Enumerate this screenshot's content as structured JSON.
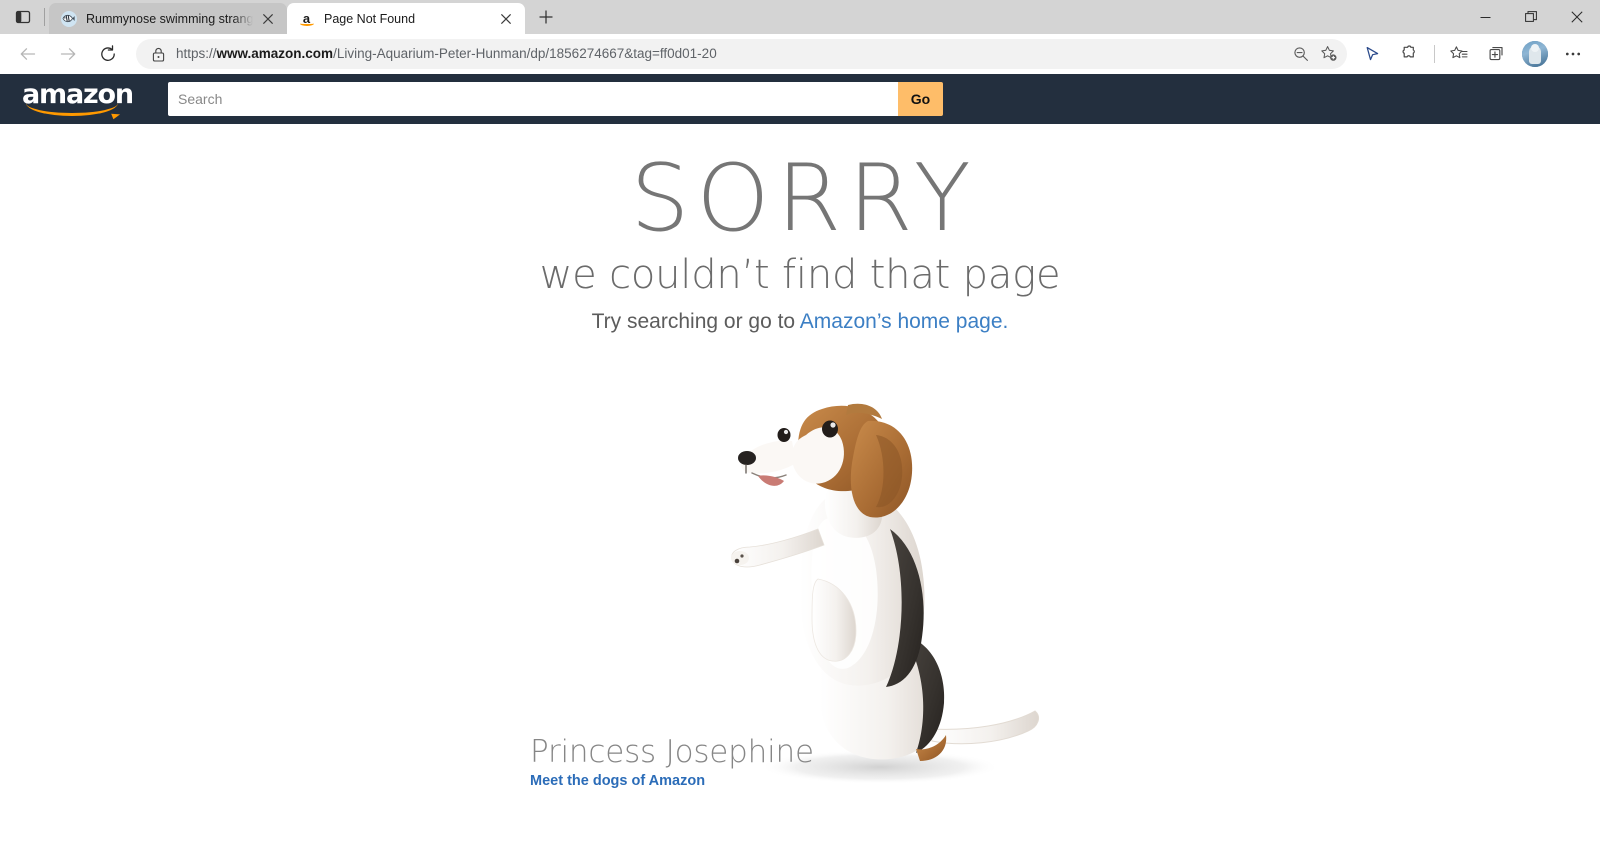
{
  "window": {
    "controls": {
      "minimize": "minimize-button",
      "maximize": "maximize-button",
      "close": "close-button"
    }
  },
  "tabstrip": {
    "tab_search_label": "Search tabs",
    "new_tab_label": "New tab",
    "tabs": [
      {
        "title": "Rummynose swimming strangely",
        "favicon": "fish-icon",
        "active": false,
        "close_label": "Close tab"
      },
      {
        "title": "Page Not Found",
        "favicon": "amazon-icon",
        "active": true,
        "close_label": "Close tab"
      }
    ]
  },
  "navbar": {
    "back_label": "Back",
    "forward_label": "Forward",
    "refresh_label": "Refresh",
    "lock_icon": "lock-icon",
    "url_prefix": "https://",
    "url_host": "www.amazon.com",
    "url_path": "/Living-Aquarium-Peter-Hunman/dp/1856274667&tag=ff0d01-20",
    "url_full": "https://www.amazon.com/Living-Aquarium-Peter-Hunman/dp/1856274667&tag=ff0d01-20",
    "zoom_out_label": "Zoom out",
    "add_favorite_label": "Add this page to favorites",
    "read_aloud_label": "Read aloud",
    "extensions_label": "Extensions",
    "favorites_label": "Favorites",
    "collections_label": "Collections",
    "profile_label": "Profile",
    "settings_label": "Settings and more"
  },
  "amazon_header": {
    "logo_text": "amazon",
    "search_placeholder": "Search",
    "search_value": "",
    "go_label": "Go",
    "bg_color": "#232f3e",
    "go_color": "#febd69"
  },
  "not_found": {
    "heading": "SORRY",
    "subheading": "we couldn’t find that page",
    "try_prefix": "Try searching or go to ",
    "home_link": "Amazon’s home page.",
    "link_color": "#3c7fc4",
    "heading_color": "#767676"
  },
  "dog": {
    "name": "Princess Josephine",
    "link": "Meet the dogs of Amazon",
    "link_color": "#2b6cb8",
    "image_alt": "beagle-photo"
  }
}
